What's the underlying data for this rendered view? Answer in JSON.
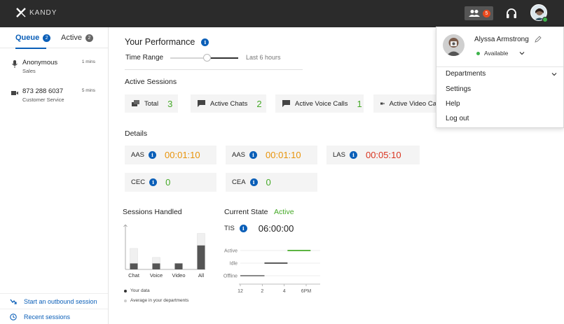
{
  "app": {
    "brand": "KANDY"
  },
  "topbar": {
    "team_badge": "5",
    "colors": {
      "background": "#2b2b2b",
      "badge": "#e8491d",
      "presence": "#3cb34a"
    }
  },
  "sidebar": {
    "tabs": [
      {
        "label": "Queue",
        "count": "2"
      },
      {
        "label": "Active",
        "count": "2"
      }
    ],
    "queue_items": [
      {
        "title": "Anonymous",
        "subtitle": "Sales",
        "time": "1 mins",
        "icon": "microphone-icon"
      },
      {
        "title": "873 288 6037",
        "subtitle": "Customer Service",
        "time": "5 mins",
        "icon": "video-icon"
      }
    ],
    "links": {
      "outbound": "Start an outbound session",
      "recent": "Recent sessions"
    }
  },
  "performance": {
    "title": "Your Performance",
    "time_range_label": "Time Range",
    "time_range_value": "Last 6 hours",
    "active_sessions_label": "Active Sessions",
    "sessions": [
      {
        "label": "Total",
        "value": "3"
      },
      {
        "label": "Active Chats",
        "value": "2"
      },
      {
        "label": "Active Voice Calls",
        "value": "1"
      },
      {
        "label": "Active Video Ca",
        "value": ""
      }
    ],
    "details_label": "Details",
    "details": [
      {
        "label": "AAS",
        "value": "00:01:10"
      },
      {
        "label": "AAS",
        "value": "00:01:10"
      },
      {
        "label": "LAS",
        "value": "00:05:10"
      },
      {
        "label": "CEC",
        "value": "0"
      },
      {
        "label": "CEA",
        "value": "0"
      }
    ],
    "sessions_handled_label": "Sessions Handled",
    "legend": {
      "yours": "Your data",
      "average": "Average in your departments"
    },
    "current_state_label": "Current State",
    "current_state_value": "Active",
    "tis_label": "TIS",
    "tis_value": "06:00:00"
  },
  "chart_data": [
    {
      "type": "bar",
      "title": "Sessions Handled",
      "categories": [
        "Chat",
        "Voice",
        "Video",
        "All"
      ],
      "series": [
        {
          "name": "Your data",
          "values": [
            2,
            2,
            2,
            8
          ]
        },
        {
          "name": "Average in your departments",
          "values": [
            7,
            4,
            2,
            12
          ]
        }
      ],
      "ylim": [
        0,
        14
      ],
      "legend": "bottom"
    },
    {
      "type": "line",
      "title": "Current State",
      "categories": [
        "Offline",
        "Idle",
        "Active"
      ],
      "x_ticks": [
        "12",
        "2",
        "4",
        "6PM"
      ],
      "x_range": [
        12,
        18
      ],
      "segments": [
        {
          "state": "Offline",
          "from": 12,
          "to": 14.2
        },
        {
          "state": "Idle",
          "from": 14.2,
          "to": 16.3
        },
        {
          "state": "Active",
          "from": 16.3,
          "to": 18.4
        }
      ]
    }
  ],
  "user_menu": {
    "name": "Alyssa Armstrong",
    "status": "Available",
    "items": {
      "departments": "Departments",
      "settings": "Settings",
      "help": "Help",
      "logout": "Log out"
    }
  }
}
